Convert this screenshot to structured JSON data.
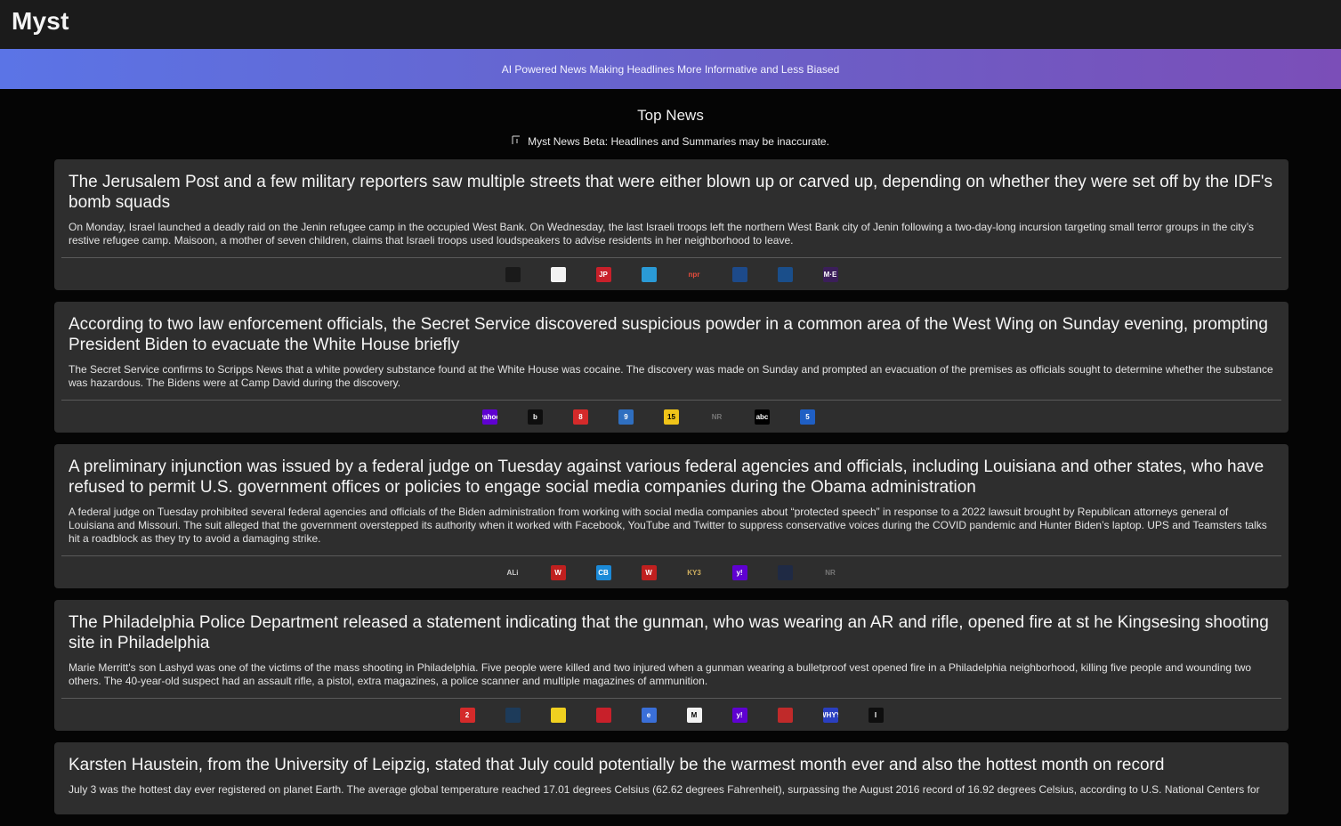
{
  "app": {
    "title": "Myst"
  },
  "banner": {
    "tagline": "AI Powered News Making Headlines More Informative and Less Biased"
  },
  "section": {
    "title": "Top News",
    "disclaimer": "Myst News Beta: Headlines and Summaries may be inaccurate."
  },
  "stories": [
    {
      "headline": "The Jerusalem Post and a few military reporters saw multiple streets that were either blown up or carved up, depending on whether they were set off by the IDF's bomb squads",
      "summary": "On Monday, Israel launched a deadly raid on the Jenin refugee camp in the occupied West Bank. On Wednesday, the last Israeli troops left the northern West Bank city of Jenin following a two-day-long incursion targeting small terror groups in the city’s restive refugee camp. Maisoon, a mother of seven children, claims that Israeli troops used loudspeakers to advise residents in her neighborhood to leave.",
      "sources": [
        {
          "icon": "source-logo-blue-figure",
          "text": "",
          "bg": "#1a1a1a",
          "fg": "#3a6fd8"
        },
        {
          "icon": "source-logo-white-block",
          "text": "",
          "bg": "#f2f2f2",
          "fg": "#111"
        },
        {
          "icon": "source-logo-jp",
          "text": "JP",
          "bg": "#c8202a",
          "fg": "#fff"
        },
        {
          "icon": "source-logo-teal",
          "text": "",
          "bg": "#2a9ad6",
          "fg": "#fff"
        },
        {
          "icon": "source-logo-npr",
          "text": "npr",
          "bg": "#2e2e2e",
          "fg": "#e74c3c"
        },
        {
          "icon": "source-logo-times-of-israel",
          "text": "",
          "bg": "#1d4a8a",
          "fg": "#fff"
        },
        {
          "icon": "source-logo-circle",
          "text": "",
          "bg": "#1a4e8a",
          "fg": "#fff"
        },
        {
          "icon": "source-logo-mee",
          "text": "M·E",
          "bg": "#3b1e5a",
          "fg": "#fff"
        }
      ]
    },
    {
      "headline": "According to two law enforcement officials, the Secret Service discovered suspicious powder in a common area of the West Wing on Sunday evening, prompting President Biden to evacuate the White House briefly",
      "summary": "The Secret Service confirms to Scripps News that a white powdery substance found at the White House was cocaine. The discovery was made on Sunday and prompted an evacuation of the premises as officials sought to determine whether the substance was hazardous. The Bidens were at Camp David during the discovery.",
      "sources": [
        {
          "icon": "source-logo-yahoo",
          "text": "yahoo",
          "bg": "#5f01d1",
          "fg": "#fff"
        },
        {
          "icon": "source-logo-b",
          "text": "b",
          "bg": "#0e0e0e",
          "fg": "#fff"
        },
        {
          "icon": "source-logo-8",
          "text": "8",
          "bg": "#d42a2a",
          "fg": "#fff"
        },
        {
          "icon": "source-logo-9",
          "text": "9",
          "bg": "#2f6fc0",
          "fg": "#fff"
        },
        {
          "icon": "source-logo-cbs15",
          "text": "15",
          "bg": "#f0c419",
          "fg": "#000"
        },
        {
          "icon": "source-logo-nr",
          "text": "NR",
          "bg": "#2e2e2e",
          "fg": "#777"
        },
        {
          "icon": "source-logo-abc",
          "text": "abc",
          "bg": "#000",
          "fg": "#fff"
        },
        {
          "icon": "source-logo-5",
          "text": "5",
          "bg": "#1f5fc4",
          "fg": "#fff"
        },
        {
          "icon": "source-logo-grey",
          "text": "",
          "bg": "#2e2e2e",
          "fg": "#555"
        }
      ]
    },
    {
      "headline": "A preliminary injunction was issued by a federal judge on Tuesday against various federal agencies and officials, including Louisiana and other states, who have refused to permit U.S. government offices or policies to engage social media companies during the Obama administration",
      "summary": "A federal judge on Tuesday prohibited several federal agencies and officials of the Biden administration from working with social media companies about “protected speech” in response to a 2022 lawsuit brought by Republican attorneys general of Louisiana and Missouri. The suit alleged that the government overstepped its authority when it worked with Facebook, YouTube and Twitter to suppress conservative voices during the COVID pandemic and Hunter Biden’s laptop. UPS and Teamsters talks hit a roadblock as they try to avoid a damaging strike.",
      "sources": [
        {
          "icon": "source-logo-ali",
          "text": "ALi",
          "bg": "#2e2e2e",
          "fg": "#ccc"
        },
        {
          "icon": "source-logo-w-red",
          "text": "W",
          "bg": "#c0201f",
          "fg": "#fff"
        },
        {
          "icon": "source-logo-cbs",
          "text": "CB",
          "bg": "#1b8ad8",
          "fg": "#fff"
        },
        {
          "icon": "source-logo-w-red-2",
          "text": "W",
          "bg": "#c0201f",
          "fg": "#fff"
        },
        {
          "icon": "source-logo-ky3",
          "text": "KY3",
          "bg": "#2e2e2e",
          "fg": "#d0b060"
        },
        {
          "icon": "source-logo-yahoo-y",
          "text": "y!",
          "bg": "#5f01d1",
          "fg": "#fff"
        },
        {
          "icon": "source-logo-dark",
          "text": "",
          "bg": "#1f2a44",
          "fg": "#333"
        },
        {
          "icon": "source-logo-nr-2",
          "text": "NR",
          "bg": "#2e2e2e",
          "fg": "#777"
        }
      ]
    },
    {
      "headline": "The Philadelphia Police Department released a statement indicating that the gunman, who was wearing an AR and rifle, opened fire at st he Kingsesing shooting site in Philadelphia",
      "summary": "Marie Merritt's son Lashyd was one of the victims of the mass shooting in Philadelphia. Five people were killed and two injured when a gunman wearing a bulletproof vest opened fire in a Philadelphia neighborhood, killing five people and wounding two others. The 40-year-old suspect had an assault rifle, a pistol, extra magazines, a police scanner and multiple magazines of ammunition.",
      "sources": [
        {
          "icon": "source-logo-2",
          "text": "2",
          "bg": "#d42a2a",
          "fg": "#fff"
        },
        {
          "icon": "source-logo-news-dark",
          "text": "",
          "bg": "#1d3b5a",
          "fg": "#fff"
        },
        {
          "icon": "source-logo-yellow",
          "text": "",
          "bg": "#f0d020",
          "fg": "#000"
        },
        {
          "icon": "source-logo-daily-voice",
          "text": "",
          "bg": "#c8202a",
          "fg": "#fff"
        },
        {
          "icon": "source-logo-globe",
          "text": "e",
          "bg": "#3a6fd8",
          "fg": "#fff"
        },
        {
          "icon": "source-logo-m",
          "text": "M",
          "bg": "#f2f2f2",
          "fg": "#000"
        },
        {
          "icon": "source-logo-yahoo-y-2",
          "text": "y!",
          "bg": "#5f01d1",
          "fg": "#fff"
        },
        {
          "icon": "source-logo-red-shape",
          "text": "",
          "bg": "#c02a2a",
          "fg": "#fff"
        },
        {
          "icon": "source-logo-whyy",
          "text": "WHYY",
          "bg": "#2a3fc0",
          "fg": "#fff"
        },
        {
          "icon": "source-logo-i",
          "text": "I",
          "bg": "#0e0e0e",
          "fg": "#fff"
        }
      ]
    },
    {
      "headline": "Karsten Haustein, from the University of Leipzig, stated that July could potentially be the warmest month ever and also the hottest month on record",
      "summary": "July 3 was the hottest day ever registered on planet Earth. The average global temperature reached 17.01 degrees Celsius (62.62 degrees Fahrenheit), surpassing the August 2016 record of 16.92 degrees Celsius, according to U.S. National Centers for",
      "sources": []
    }
  ]
}
